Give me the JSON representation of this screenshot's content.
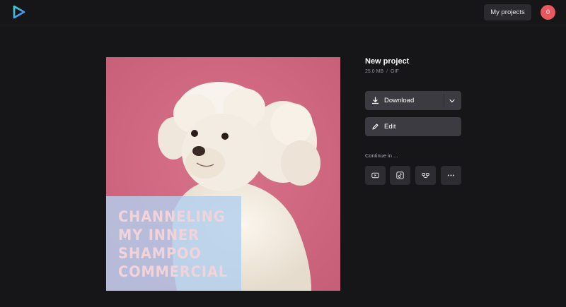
{
  "header": {
    "logo_icon": "play-logo-icon",
    "my_projects_label": "My projects",
    "avatar_initial": "0"
  },
  "preview": {
    "caption_lines": [
      "CHANNELING",
      "MY INNER",
      "SHAMPOO",
      "COMMERCIAL"
    ],
    "background_color": "#cf6a82"
  },
  "project": {
    "title": "New project",
    "size": "25.0 MB",
    "separator": "/",
    "format": "GIF"
  },
  "actions": {
    "download_label": "Download",
    "edit_label": "Edit"
  },
  "continue": {
    "label": "Continue in ...",
    "targets": [
      "youtube-icon",
      "tiktok-icon",
      "people-icon",
      "more-icon"
    ]
  },
  "colors": {
    "background": "#161619",
    "button": "#3b3b41",
    "avatar": "#e9585f"
  }
}
